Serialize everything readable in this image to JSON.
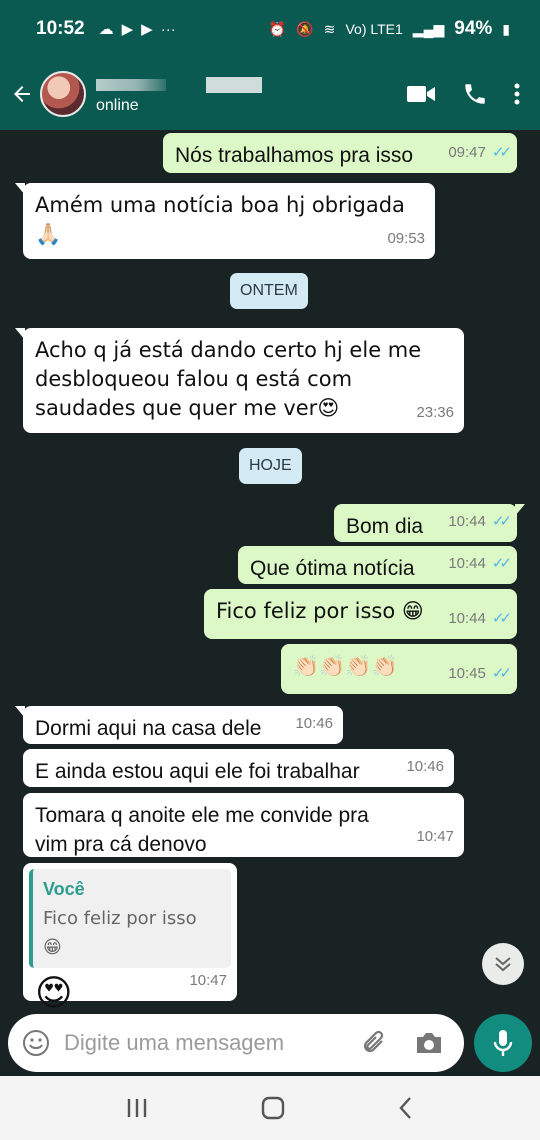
{
  "status_bar": {
    "time": "10:52",
    "icons_left": [
      "weather-icon",
      "youtube-icon",
      "youtube-icon",
      "more-dots-icon"
    ],
    "network": "Vo) LTE1",
    "battery": "94%"
  },
  "app_bar": {
    "contact_status": "online",
    "accent_color": "#0b5a52"
  },
  "dates": {
    "yesterday": "ONTEM",
    "today": "HOJE"
  },
  "messages": [
    {
      "dir": "out",
      "text": "Nós trabalhamos pra isso",
      "time": "09:47"
    },
    {
      "dir": "in",
      "text": "Amém uma notícia boa hj obrigada 🙏🏻",
      "time": "09:53"
    },
    {
      "dir": "in",
      "text": "Acho q já está dando certo hj ele me desbloqueou falou q está com saudades que quer me ver😍",
      "time": "23:36"
    },
    {
      "dir": "out",
      "text": "Bom dia",
      "time": "10:44"
    },
    {
      "dir": "out",
      "text": "Que ótima notícia",
      "time": "10:44"
    },
    {
      "dir": "out",
      "text": "Fico feliz por isso 😁",
      "time": "10:44"
    },
    {
      "dir": "out",
      "text": "👏🏻👏🏻👏🏻👏🏻",
      "time": "10:45"
    },
    {
      "dir": "in",
      "text": "Dormi aqui na casa dele",
      "time": "10:46"
    },
    {
      "dir": "in",
      "text": "E ainda estou aqui ele foi trabalhar",
      "time": "10:46"
    },
    {
      "dir": "in",
      "text": "Tomara q anoite ele me convide pra vim pra cá denovo",
      "time": "10:47"
    },
    {
      "dir": "in",
      "reply_author": "Você",
      "reply_text": "Fico feliz por isso 😁",
      "text": "😍",
      "time": "10:47"
    }
  ],
  "input": {
    "placeholder": "Digite uma mensagem"
  }
}
